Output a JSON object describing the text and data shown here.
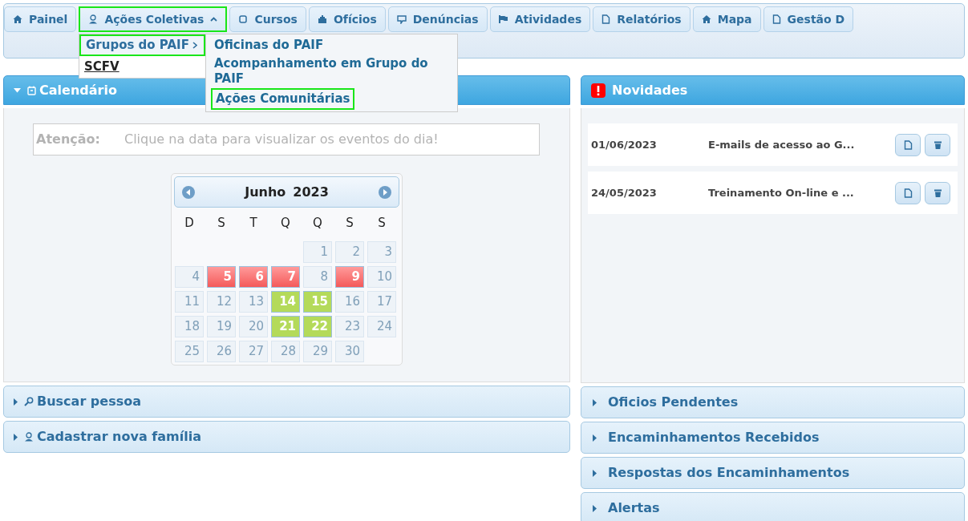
{
  "menu": {
    "tabs": [
      {
        "label": "Painel",
        "selected": false,
        "expanded": false
      },
      {
        "label": "Ações Coletivas",
        "selected": true,
        "expanded": true
      },
      {
        "label": "Cursos",
        "selected": false,
        "expanded": false
      },
      {
        "label": "Ofícios",
        "selected": false,
        "expanded": false
      },
      {
        "label": "Denúncias",
        "selected": false,
        "expanded": false
      },
      {
        "label": "Atividades",
        "selected": false,
        "expanded": false
      },
      {
        "label": "Relatórios",
        "selected": false,
        "expanded": false
      },
      {
        "label": "Mapa",
        "selected": false,
        "expanded": false
      },
      {
        "label": "Gestão D",
        "selected": false,
        "expanded": false
      }
    ],
    "dropdown": [
      {
        "label": "Grupos do PAIF",
        "selected": true,
        "has_submenu": true
      },
      {
        "label": "SCFV",
        "selected": false,
        "has_submenu": false
      }
    ],
    "submenu": [
      {
        "label": "Oficinas do PAIF",
        "selected": false
      },
      {
        "label": "Acompanhamento em Grupo do PAIF",
        "selected": false
      },
      {
        "label": "Ações Comunitárias",
        "selected": true
      }
    ]
  },
  "calendar_panel": {
    "title": "Calendário",
    "expanded": true,
    "notice_label": "Atenção:",
    "notice_text": "Clique na data para visualizar os eventos do dia!",
    "month": "Junho",
    "year": "2023",
    "weekdays": [
      "D",
      "S",
      "T",
      "Q",
      "Q",
      "S",
      "S"
    ],
    "weeks": [
      [
        {
          "kind": "empty"
        },
        {
          "kind": "empty"
        },
        {
          "kind": "empty"
        },
        {
          "kind": "empty"
        },
        {
          "day": "1",
          "kind": "normal"
        },
        {
          "day": "2",
          "kind": "normal"
        },
        {
          "day": "3",
          "kind": "normal"
        }
      ],
      [
        {
          "day": "4",
          "kind": "normal"
        },
        {
          "day": "5",
          "kind": "alert"
        },
        {
          "day": "6",
          "kind": "alert"
        },
        {
          "day": "7",
          "kind": "alert"
        },
        {
          "day": "8",
          "kind": "normal"
        },
        {
          "day": "9",
          "kind": "alert"
        },
        {
          "day": "10",
          "kind": "normal"
        }
      ],
      [
        {
          "day": "11",
          "kind": "normal"
        },
        {
          "day": "12",
          "kind": "normal"
        },
        {
          "day": "13",
          "kind": "normal"
        },
        {
          "day": "14",
          "kind": "event"
        },
        {
          "day": "15",
          "kind": "event"
        },
        {
          "day": "16",
          "kind": "normal"
        },
        {
          "day": "17",
          "kind": "normal"
        }
      ],
      [
        {
          "day": "18",
          "kind": "normal"
        },
        {
          "day": "19",
          "kind": "normal"
        },
        {
          "day": "20",
          "kind": "normal"
        },
        {
          "day": "21",
          "kind": "event"
        },
        {
          "day": "22",
          "kind": "event"
        },
        {
          "day": "23",
          "kind": "normal"
        },
        {
          "day": "24",
          "kind": "normal"
        }
      ],
      [
        {
          "day": "25",
          "kind": "normal"
        },
        {
          "day": "26",
          "kind": "normal"
        },
        {
          "day": "27",
          "kind": "normal"
        },
        {
          "day": "28",
          "kind": "normal"
        },
        {
          "day": "29",
          "kind": "normal"
        },
        {
          "day": "30",
          "kind": "normal"
        },
        {
          "kind": "empty"
        }
      ]
    ]
  },
  "left_sections": [
    {
      "title": "Buscar pessoa",
      "expanded": false
    },
    {
      "title": "Cadastrar nova família",
      "expanded": false
    }
  ],
  "news_panel": {
    "title": "Novidades",
    "items": [
      {
        "date": "01/06/2023",
        "title": "E-mails de acesso ao G..."
      },
      {
        "date": "24/05/2023",
        "title": "Treinamento On-line e ..."
      }
    ]
  },
  "right_sections": [
    {
      "title": "Oficios Pendentes",
      "expanded": false
    },
    {
      "title": "Encaminhamentos Recebidos",
      "expanded": false
    },
    {
      "title": "Respostas dos Encaminhamentos",
      "expanded": false
    },
    {
      "title": "Alertas",
      "expanded": false
    }
  ]
}
